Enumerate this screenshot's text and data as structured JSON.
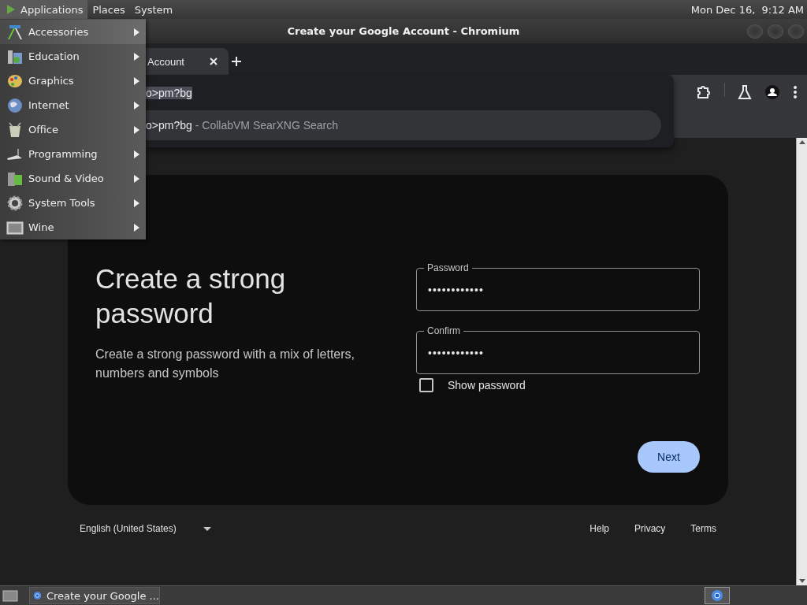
{
  "top_panel": {
    "menus": [
      {
        "label": "Applications",
        "selected": true
      },
      {
        "label": "Places",
        "selected": false
      },
      {
        "label": "System",
        "selected": false
      }
    ],
    "clock": "Mon Dec 16,  9:12 AM"
  },
  "window": {
    "title": "Create your Google Account - Chromium"
  },
  "tabs": [
    {
      "label": "Account",
      "selected": true
    }
  ],
  "omnibox": {
    "text": "o>pm?bg",
    "suggestions": [
      {
        "text": "o>pm?bg",
        "detail": "- CollabVM SearXNG Search",
        "selected": true
      }
    ]
  },
  "page": {
    "heading": "Create a strong password",
    "subtitle": "Create a strong password with a mix of letters, numbers and symbols",
    "fields": [
      {
        "label": "Password",
        "value": "••••••••••••"
      },
      {
        "label": "Confirm",
        "value": "••••••••••••"
      }
    ],
    "show_password": {
      "label": "Show password",
      "checked": false
    },
    "next_button": "Next",
    "language": "English (United States)",
    "footer_links": [
      "Help",
      "Privacy",
      "Terms"
    ]
  },
  "applications_menu": [
    {
      "label": "Accessories",
      "selected": true
    },
    {
      "label": "Education",
      "selected": false
    },
    {
      "label": "Graphics",
      "selected": false
    },
    {
      "label": "Internet",
      "selected": false
    },
    {
      "label": "Office",
      "selected": false
    },
    {
      "label": "Programming",
      "selected": false
    },
    {
      "label": "Sound & Video",
      "selected": false
    },
    {
      "label": "System Tools",
      "selected": false
    },
    {
      "label": "Wine",
      "selected": false
    }
  ],
  "taskbar": {
    "tasks": [
      {
        "label": "Create your Google ...",
        "selected": false
      }
    ]
  }
}
